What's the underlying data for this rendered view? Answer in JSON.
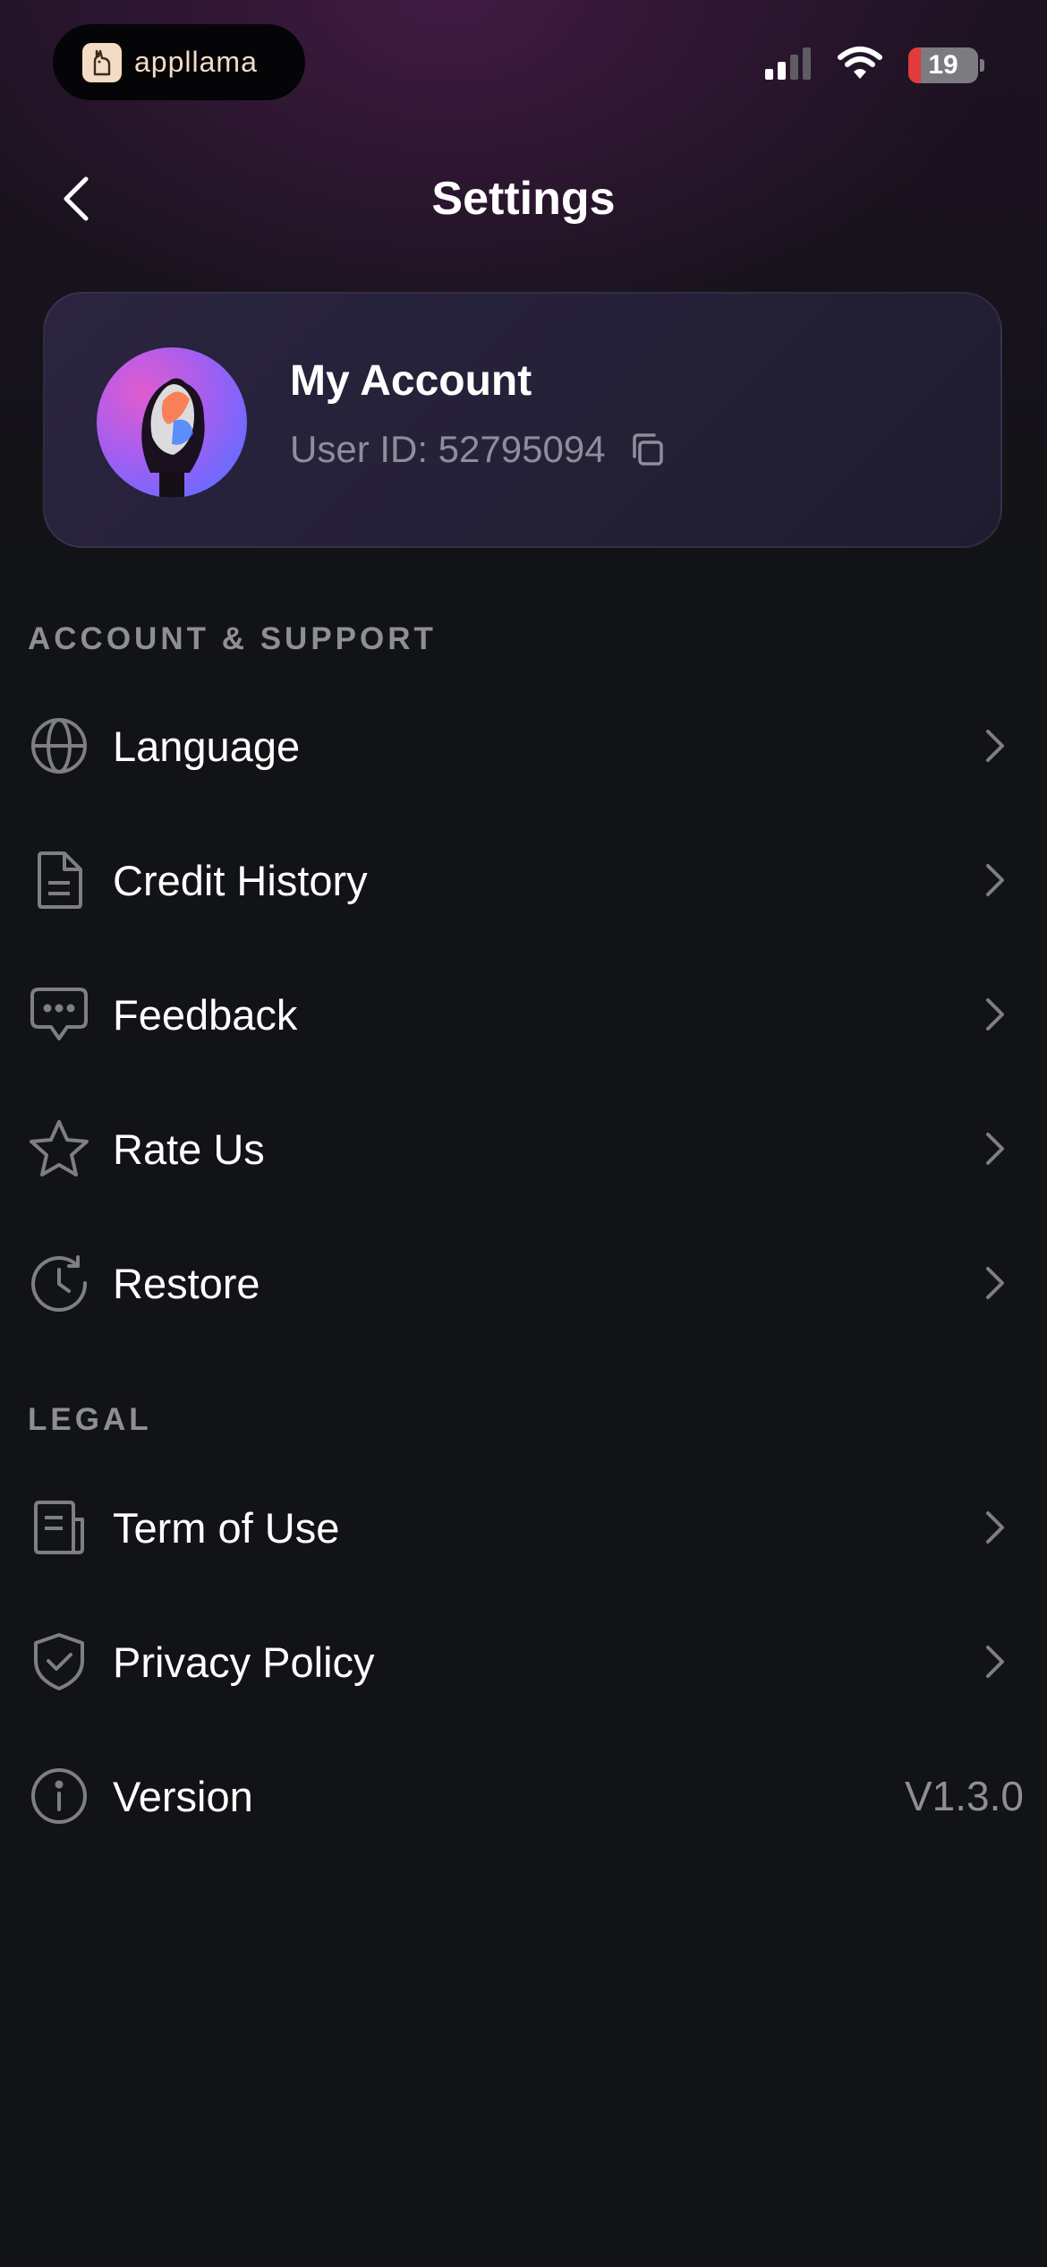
{
  "status_bar": {
    "app_pill_label": "appllama",
    "battery_level": "19"
  },
  "nav": {
    "title": "Settings"
  },
  "account": {
    "name": "My Account",
    "user_id_label": "User ID: 52795094"
  },
  "sections": {
    "support": {
      "header": "ACCOUNT & SUPPORT",
      "items": [
        {
          "label": "Language",
          "icon": "globe-icon"
        },
        {
          "label": "Credit History",
          "icon": "document-icon"
        },
        {
          "label": "Feedback",
          "icon": "chat-bubble-icon"
        },
        {
          "label": "Rate Us",
          "icon": "star-icon"
        },
        {
          "label": "Restore",
          "icon": "restore-clock-icon"
        }
      ]
    },
    "legal": {
      "header": "LEGAL",
      "items": [
        {
          "label": "Term of Use",
          "icon": "terms-document-icon"
        },
        {
          "label": "Privacy Policy",
          "icon": "shield-check-icon"
        },
        {
          "label": "Version",
          "icon": "info-icon",
          "value": "V1.3.0"
        }
      ]
    }
  },
  "colors": {
    "background": "#121316",
    "card": "#252038",
    "muted_text": "#8e8e96",
    "icon_stroke": "#7e7e86",
    "battery_low": "#e33b3b"
  }
}
